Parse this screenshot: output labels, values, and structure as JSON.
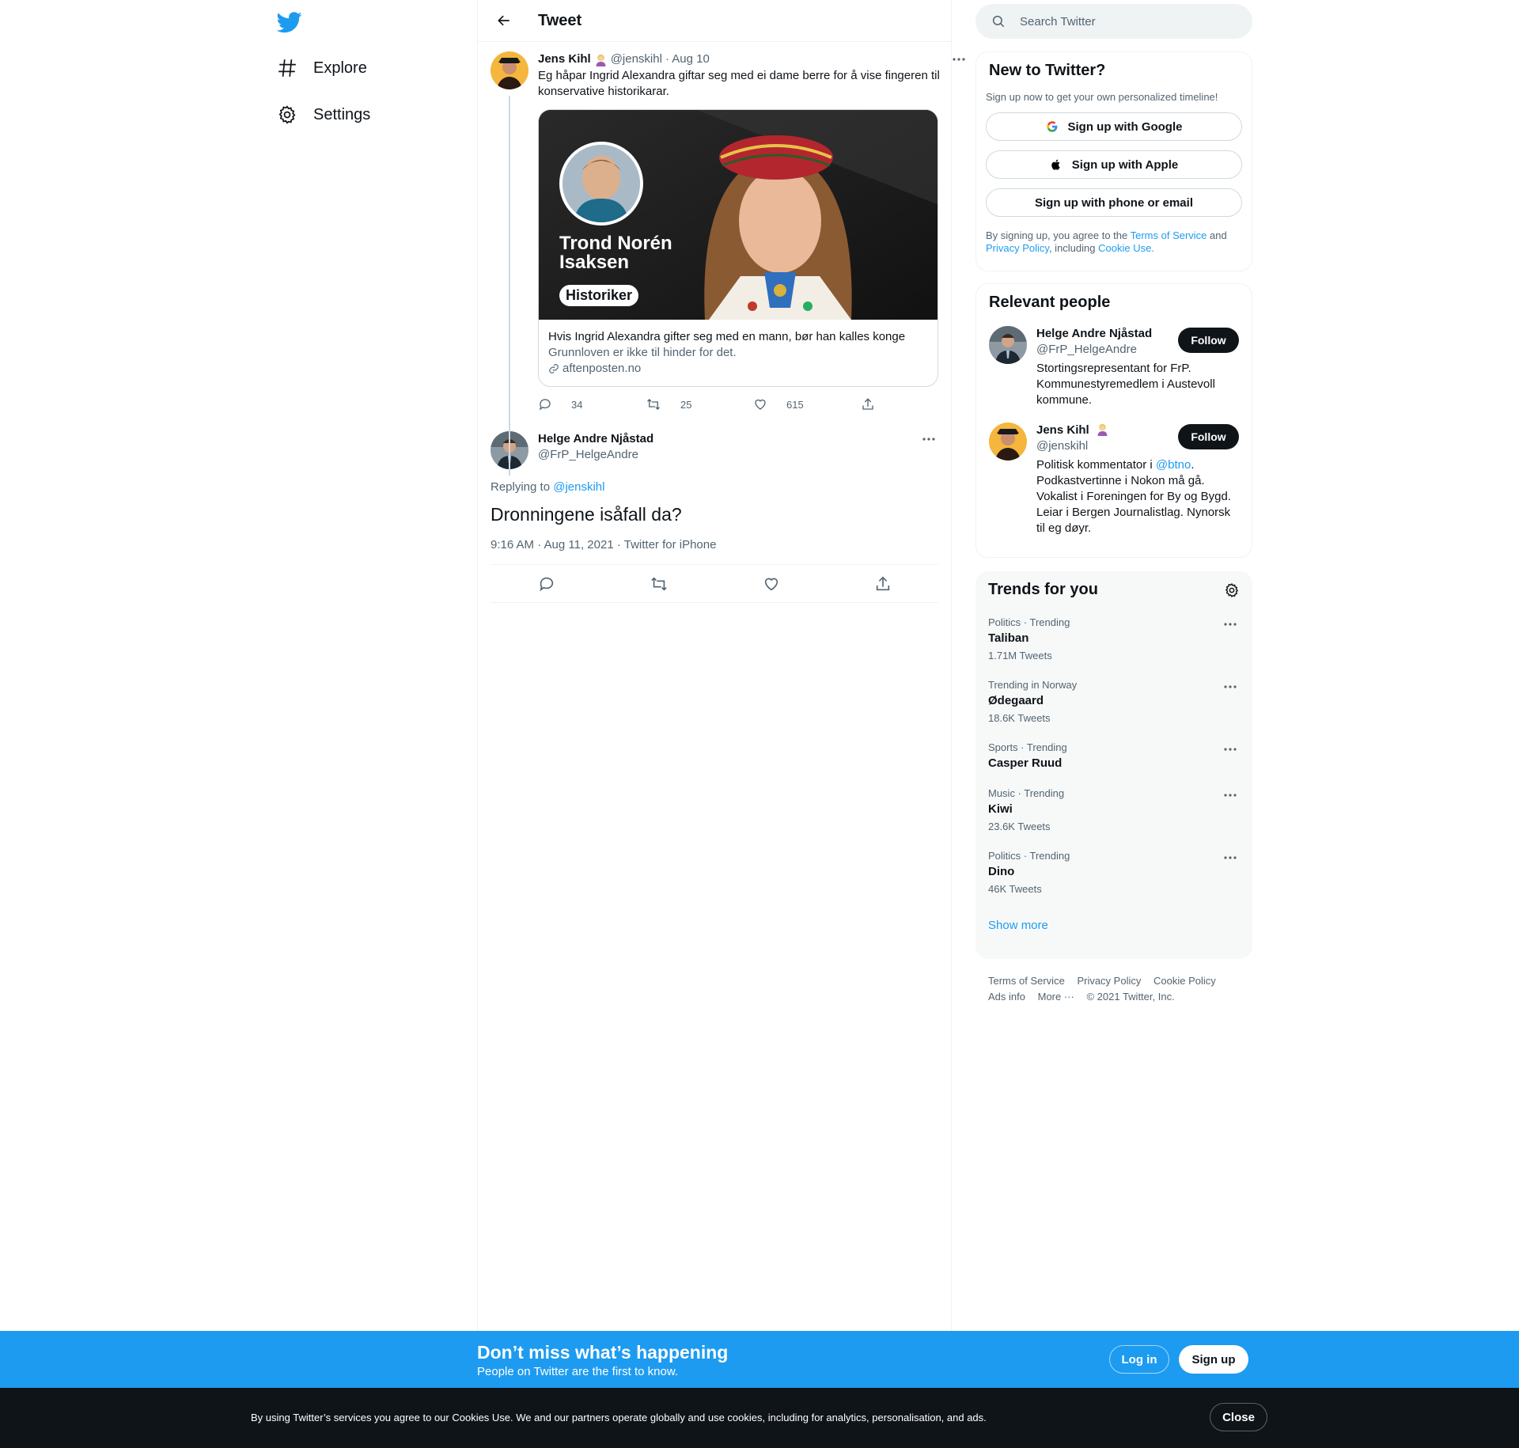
{
  "nav": {
    "logo_icon": "twitter-bird-icon",
    "items": [
      {
        "label": "Explore",
        "icon": "hashtag-icon"
      },
      {
        "label": "Settings",
        "icon": "gear-icon"
      }
    ]
  },
  "main": {
    "title": "Tweet",
    "quoted_tweet": {
      "name": "Jens Kihl",
      "handle": "@jenskihl",
      "date": "· Aug 10",
      "text": "Eg håpar Ingrid Alexandra giftar seg med ei dame berre for å vise fingeren til konservative historikarar.",
      "card": {
        "overlay_name": "Trond Norén Isaksen",
        "overlay_tag": "Historiker",
        "title": "Hvis Ingrid Alexandra gifter seg med en mann, bør han kalles konge",
        "description": "Grunnloven er ikke til hinder for det.",
        "domain": "aftenposten.no"
      },
      "stats": {
        "replies": "34",
        "retweets": "25",
        "likes": "615"
      }
    },
    "reply": {
      "name": "Helge Andre Njåstad",
      "handle": "@FrP_HelgeAndre",
      "replying_prefix": "Replying to ",
      "replying_to": "@jenskihl",
      "text": "Dronningene isåfall da?",
      "meta": "9:16 AM · Aug 11, 2021 · Twitter for iPhone"
    }
  },
  "search": {
    "placeholder": "Search Twitter"
  },
  "new_to_twitter": {
    "title": "New to Twitter?",
    "subtitle": "Sign up now to get your own personalized timeline!",
    "google_label": "Sign up with Google",
    "apple_label": "Sign up with Apple",
    "email_label": "Sign up with phone or email",
    "legal_1": "By signing up, you agree to the ",
    "tos": "Terms of Service",
    "legal_2": " and ",
    "privacy": "Privacy Policy",
    "legal_3": ", including ",
    "cookie": "Cookie Use."
  },
  "relevant": {
    "title": "Relevant people",
    "follow_label": "Follow",
    "people": [
      {
        "name": "Helge Andre Njåstad",
        "handle": "@FrP_HelgeAndre",
        "bio": "Stortingsrepresentant for FrP. Kommunestyremedlem i Austevoll kommune."
      },
      {
        "name": "Jens Kihl",
        "handle": "@jenskihl",
        "bio_prefix": "Politisk kommentator i ",
        "bio_link": "@btno",
        "bio_suffix": ". Podkastvertinne i Nokon må gå. Vokalist i Foreningen for By og Bygd. Leiar i Bergen Journalistlag. Nynorsk til eg døyr."
      }
    ]
  },
  "trends": {
    "title": "Trends for you",
    "items": [
      {
        "category": "Politics · Trending",
        "name": "Taliban",
        "count": "1.71M Tweets"
      },
      {
        "category": "Trending in Norway",
        "name": "Ødegaard",
        "count": "18.6K Tweets"
      },
      {
        "category": "Sports · Trending",
        "name": "Casper Ruud",
        "count": ""
      },
      {
        "category": "Music · Trending",
        "name": "Kiwi",
        "count": "23.6K Tweets"
      },
      {
        "category": "Politics · Trending",
        "name": "Dino",
        "count": "46K Tweets"
      }
    ],
    "show_more": "Show more"
  },
  "footer": {
    "links": [
      "Terms of Service",
      "Privacy Policy",
      "Cookie Policy",
      "Ads info",
      "More ···",
      "© 2021 Twitter, Inc."
    ]
  },
  "bottom_bar": {
    "title": "Don’t miss what’s happening",
    "subtitle": "People on Twitter are the first to know.",
    "login": "Log in",
    "signup": "Sign up"
  },
  "cookie_bar": {
    "text": "By using Twitter’s services you agree to our Cookies Use. We and our partners operate globally and use cookies, including for analytics, personalisation, and ads.",
    "close": "Close"
  },
  "colors": {
    "accent": "#1d9bf0",
    "text": "#0f1419",
    "secondary": "#536471"
  }
}
